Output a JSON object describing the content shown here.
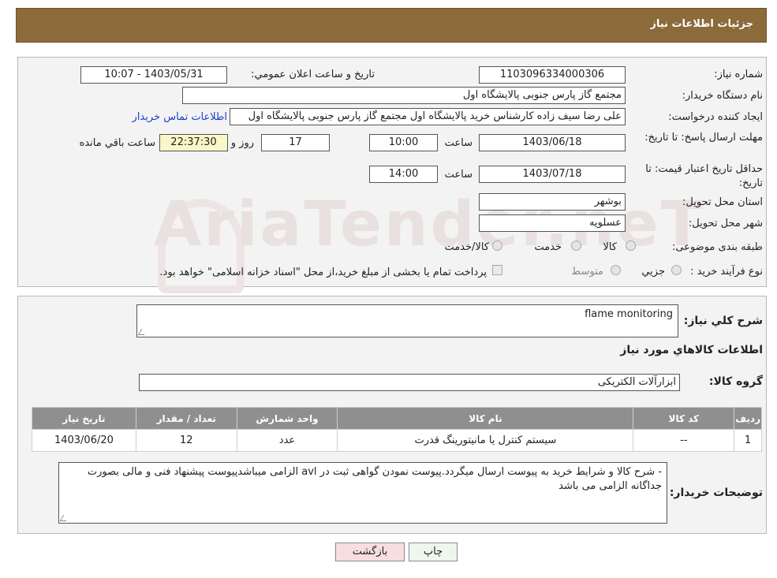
{
  "header": {
    "title": "جزئیات اطلاعات نیاز"
  },
  "form": {
    "need_number_label": "شماره نیاز:",
    "need_number": "1103096334000306",
    "announce_label": "تاریخ و ساعت اعلان عمومي:",
    "announce_value": "1403/05/31 - 10:07",
    "buyer_org_label": "نام دستگاه خريدار:",
    "buyer_org": "مجتمع گاز پارس جنوبی  پالایشگاه اول",
    "creator_label": "ايجاد كننده درخواست:",
    "creator": "علی رضا سیف زاده کارشناس خرید پالایشگاه اول مجتمع گاز پارس جنوبی  پالایشگاه اول",
    "contact_link": "اطلاعات تماس خريدار",
    "deadline_label": "مهلت ارسال پاسخ: تا تاريخ:",
    "deadline_date": "1403/06/18",
    "time_label": "ساعت",
    "deadline_time": "10:00",
    "days_value": "17",
    "days_label": "روز و",
    "remaining_time": "22:37:30",
    "remaining_label": "ساعت باقي مانده",
    "validity_label": "حداقل تاريخ اعتبار قيمت: تا تاريخ:",
    "validity_date": "1403/07/18",
    "validity_time": "14:00",
    "province_label": "استان محل تحويل:",
    "province": "بوشهر",
    "city_label": "شهر محل تحويل:",
    "city": "عسلويه",
    "category_label": "طبقه بندی موضوعی:",
    "category_options": [
      "کالا",
      "خدمت",
      "کالا/خدمت"
    ],
    "process_label": "نوع فرآيند خريد :",
    "process_options": [
      "جزيي",
      "متوسط"
    ],
    "process_note": "پرداخت تمام يا بخشی از مبلغ خريد،از محل \"اسناد خزانه اسلامی\" خواهد بود."
  },
  "details": {
    "summary_label": "شرح كلي نياز:",
    "summary": "flame monitoring",
    "items_heading": "اطلاعات كالاهاي مورد نياز",
    "group_label": "گروه كالا:",
    "group": "ابزارآلات الکتریکی",
    "table": {
      "headers": [
        "رديف",
        "كد كالا",
        "نام كالا",
        "واحد شمارش",
        "تعداد / مقدار",
        "تاريخ نياز"
      ],
      "rows": [
        [
          "1",
          "--",
          "سیستم کنترل یا مانیتورینگ قدرت",
          "عدد",
          "12",
          "1403/06/20"
        ]
      ]
    },
    "buyer_notes_label": "توضيحات خريدار:",
    "buyer_notes": "-  شرح کالا و شرایط خرید به پیوست ارسال میگردد.پیوست نمودن گواهی ثبت در avl الزامی میباشدپیوست پیشنهاد فنی و مالی بصورت جداگانه الزامی می باشد"
  },
  "buttons": {
    "print": "چاپ",
    "back": "بازگشت"
  },
  "watermark": "AriaTender.neT",
  "colors": {
    "header_bg": "#8c6a3a",
    "table_header": "#8f8f8f",
    "link": "#1a3fcc",
    "back_button": "#f8dede"
  }
}
